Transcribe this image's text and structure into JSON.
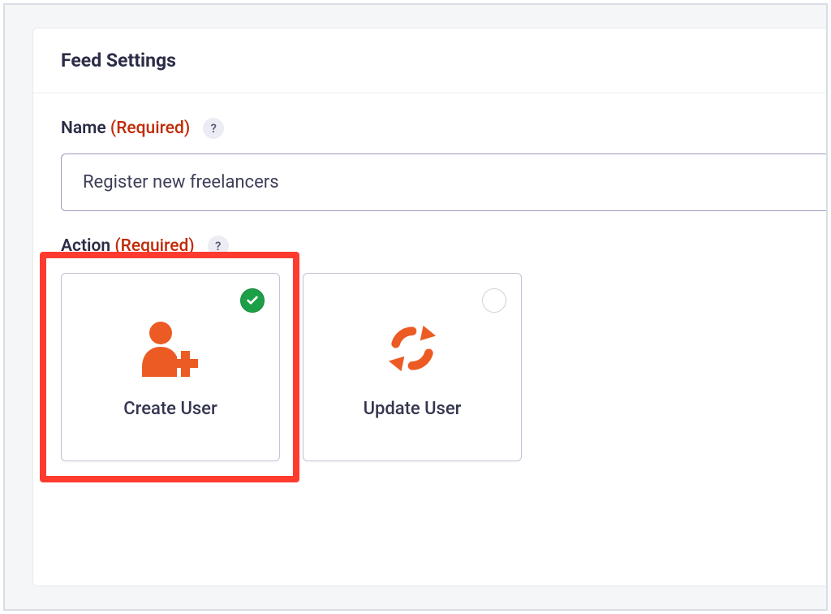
{
  "panel": {
    "title": "Feed Settings"
  },
  "fields": {
    "name": {
      "label": "Name",
      "required_text": "(Required)",
      "help": "?",
      "value": "Register new freelancers"
    },
    "action": {
      "label": "Action",
      "required_text": "(Required)",
      "help": "?",
      "options": [
        {
          "label": "Create User",
          "selected": true
        },
        {
          "label": "Update User",
          "selected": false
        }
      ]
    }
  },
  "colors": {
    "accent": "#ec5b23",
    "required": "#c02b07",
    "highlight": "#ff3b30",
    "success": "#1ba047"
  }
}
